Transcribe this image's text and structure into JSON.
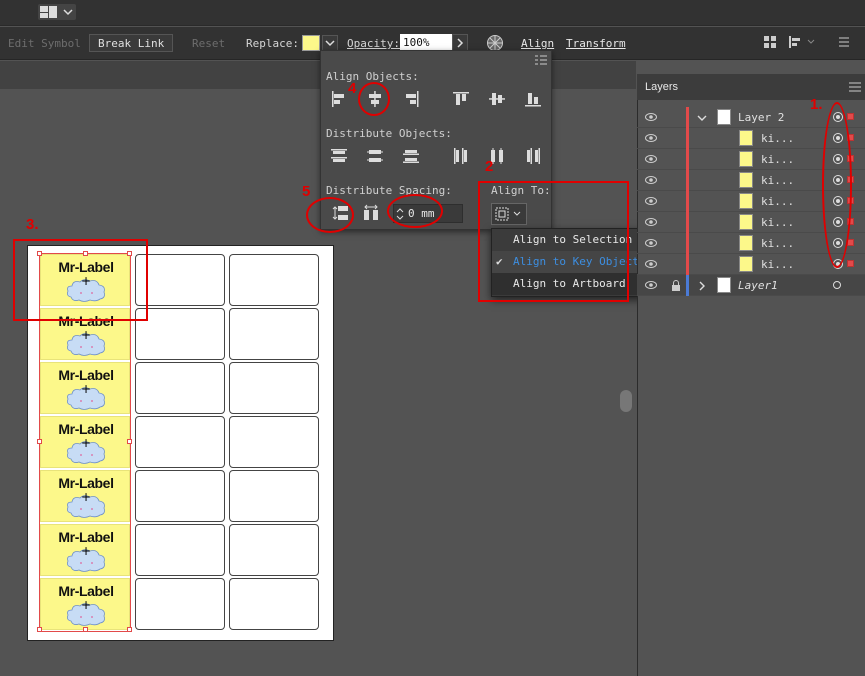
{
  "control_bar": {
    "edit_symbol": "Edit Symbol",
    "break_link": "Break Link",
    "reset": "Reset",
    "replace_label": "Replace:",
    "opacity_label": "Opacity:",
    "opacity_value": "100%",
    "align": "Align",
    "transform": "Transform"
  },
  "align_panel": {
    "align_objects": "Align Objects:",
    "distribute_objects": "Distribute Objects:",
    "distribute_spacing": "Distribute Spacing:",
    "spacing_value": "0 mm",
    "align_to": "Align To:"
  },
  "align_to_menu": [
    {
      "label": "Align to Selection",
      "checked": false
    },
    {
      "label": "Align to Key Object",
      "checked": true
    },
    {
      "label": "Align to Artboard",
      "checked": false
    }
  ],
  "layers": {
    "tab": "Layers",
    "rows": [
      {
        "name": "Layer 2",
        "type": "layer"
      },
      {
        "name": "ki...",
        "type": "item"
      },
      {
        "name": "ki...",
        "type": "item"
      },
      {
        "name": "ki...",
        "type": "item"
      },
      {
        "name": "ki...",
        "type": "item"
      },
      {
        "name": "ki...",
        "type": "item"
      },
      {
        "name": "ki...",
        "type": "item"
      },
      {
        "name": "ki...",
        "type": "item"
      },
      {
        "name": "Layer1",
        "type": "layer"
      }
    ]
  },
  "labels": [
    "Mr-Label",
    "Mr-Label",
    "Mr-Label",
    "Mr-Label",
    "Mr-Label",
    "Mr-Label",
    "Mr-Label"
  ],
  "annotations": [
    "1.",
    "2",
    "3.",
    "4",
    "5"
  ]
}
